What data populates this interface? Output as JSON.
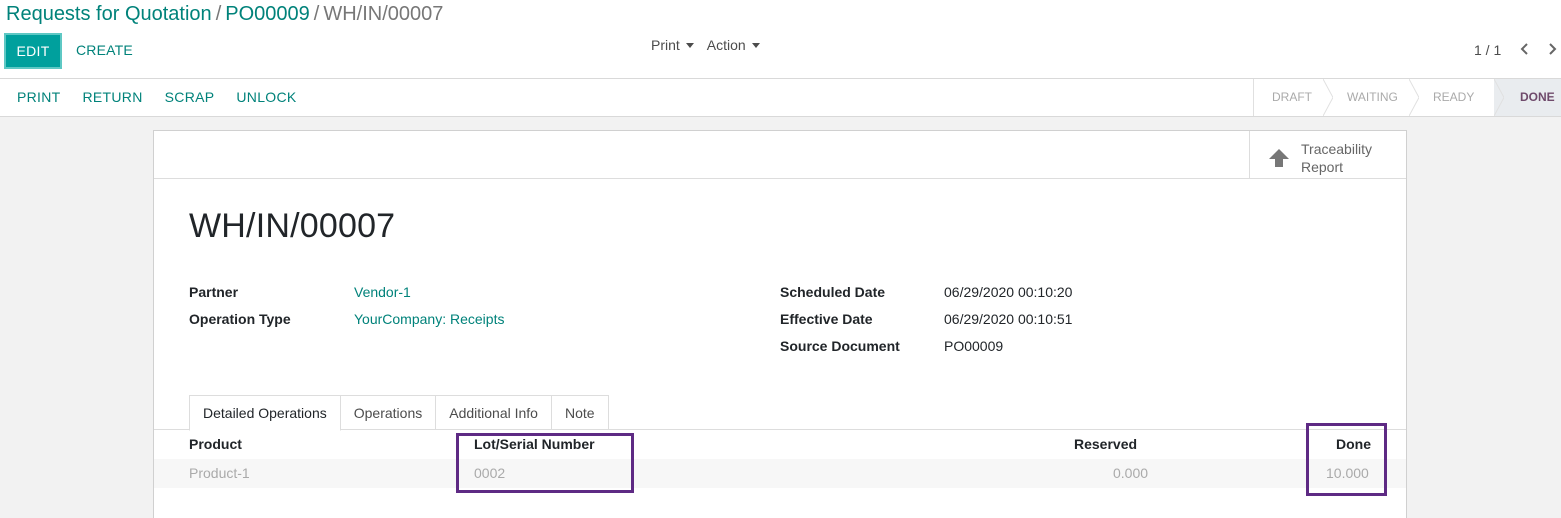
{
  "breadcrumb": {
    "items": [
      "Requests for Quotation",
      "PO00009"
    ],
    "current": "WH/IN/00007",
    "separator": "/"
  },
  "toolbar": {
    "edit_label": "EDIT",
    "create_label": "CREATE",
    "print_menu": "Print",
    "action_menu": "Action",
    "pager": "1 / 1"
  },
  "statusbar": {
    "buttons": [
      "PRINT",
      "RETURN",
      "SCRAP",
      "UNLOCK"
    ],
    "stages": [
      "DRAFT",
      "WAITING",
      "READY",
      "DONE"
    ],
    "active_stage": "DONE"
  },
  "button_box": {
    "traceability_line1": "Traceability",
    "traceability_line2": "Report"
  },
  "record": {
    "name": "WH/IN/00007",
    "partner_label": "Partner",
    "partner_value": "Vendor-1",
    "operation_type_label": "Operation Type",
    "operation_type_value": "YourCompany: Receipts",
    "scheduled_date_label": "Scheduled Date",
    "scheduled_date_value": "06/29/2020 00:10:20",
    "effective_date_label": "Effective Date",
    "effective_date_value": "06/29/2020 00:10:51",
    "source_document_label": "Source Document",
    "source_document_value": "PO00009"
  },
  "tabs": [
    "Detailed Operations",
    "Operations",
    "Additional Info",
    "Note"
  ],
  "table": {
    "columns": [
      "Product",
      "Lot/Serial Number",
      "Reserved",
      "Done"
    ],
    "rows": [
      [
        "Product-1",
        "0002",
        "0.000",
        "10.000"
      ]
    ]
  },
  "colors": {
    "primary": "#00a09d",
    "link": "#00827a",
    "highlight_box": "#5e2a84",
    "active_stage_text": "#6f4a6b"
  }
}
